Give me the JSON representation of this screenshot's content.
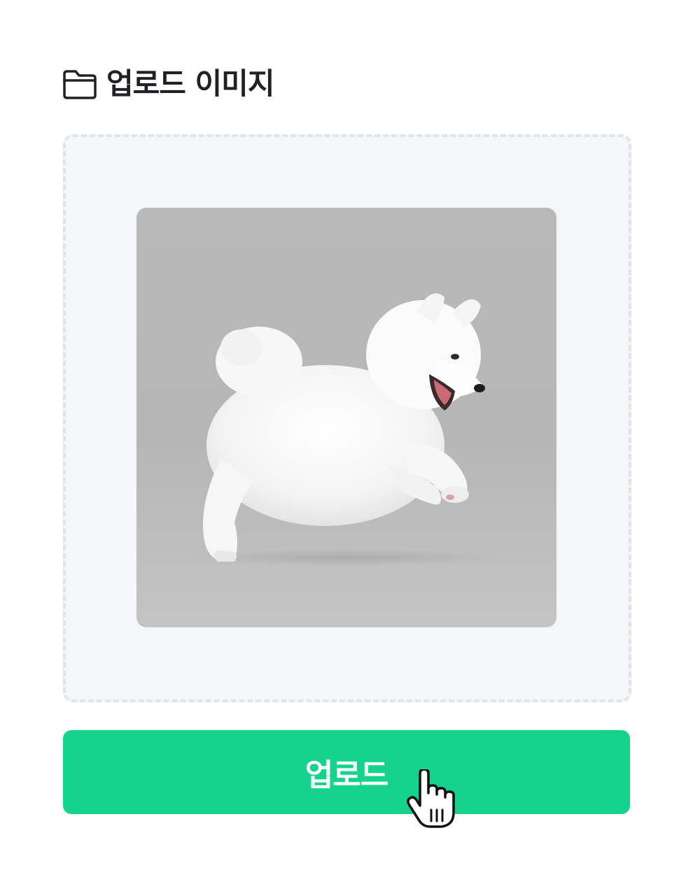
{
  "header": {
    "icon": "folder-icon",
    "title": "업로드 이미지"
  },
  "dropzone": {
    "preview_image": "white-samoyed-puppy-jumping-photo"
  },
  "upload_button": {
    "label": "업로드",
    "color": "#15d28c"
  },
  "cursor": {
    "icon": "hand-pointer-cursor-icon"
  },
  "colors": {
    "title_text": "#1f2125",
    "dropzone_bg": "#f5f6f8",
    "dropzone_border": "#e3e4e8",
    "button_text": "#ffffff"
  }
}
